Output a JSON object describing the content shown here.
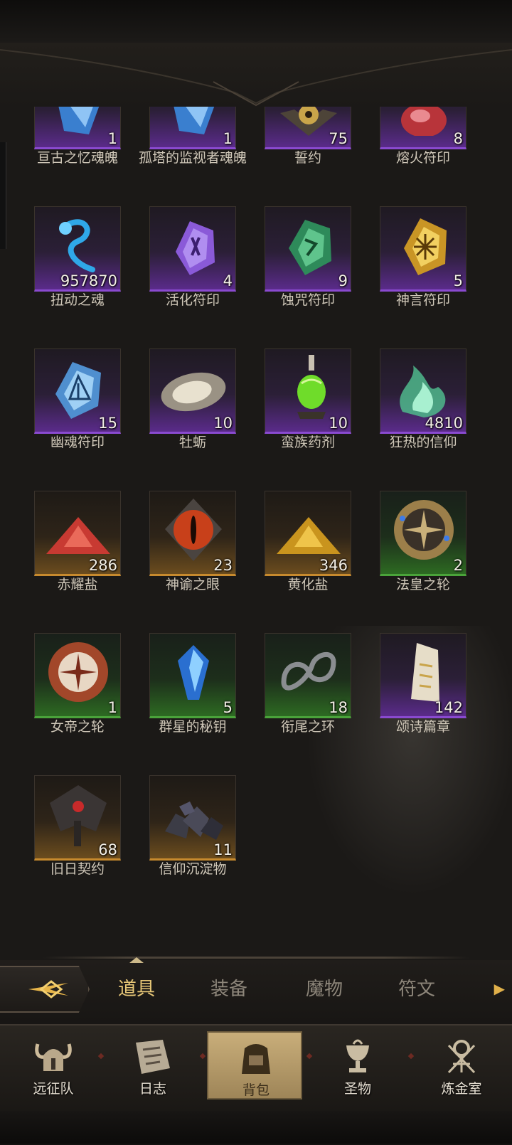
{
  "inventory": {
    "items": [
      {
        "name": "亘古之忆魂魄",
        "count": "1",
        "rarity": "purple",
        "icon": "blue-crystal-soul-icon"
      },
      {
        "name": "孤塔的监视者魂魄",
        "count": "1",
        "rarity": "purple",
        "icon": "blue-crystal-soul-icon"
      },
      {
        "name": "誓约",
        "count": "75",
        "rarity": "purple",
        "icon": "golden-eye-emblem-icon"
      },
      {
        "name": "熔火符印",
        "count": "8",
        "rarity": "purple",
        "icon": "red-rune-stone-icon"
      },
      {
        "name": "扭动之魂",
        "count": "957870",
        "rarity": "purple",
        "icon": "blue-wisp-soul-icon"
      },
      {
        "name": "活化符印",
        "count": "4",
        "rarity": "purple",
        "icon": "purple-rune-stone-icon"
      },
      {
        "name": "蚀咒符印",
        "count": "9",
        "rarity": "purple",
        "icon": "green-rune-stone-icon"
      },
      {
        "name": "神言符印",
        "count": "5",
        "rarity": "purple",
        "icon": "gold-rune-stone-icon"
      },
      {
        "name": "幽魂符印",
        "count": "15",
        "rarity": "purple",
        "icon": "ice-rune-stone-icon"
      },
      {
        "name": "牡蛎",
        "count": "10",
        "rarity": "purple",
        "icon": "oyster-icon"
      },
      {
        "name": "蛮族药剂",
        "count": "10",
        "rarity": "purple",
        "icon": "green-potion-icon"
      },
      {
        "name": "狂热的信仰",
        "count": "4810",
        "rarity": "purple",
        "icon": "green-flame-icon"
      },
      {
        "name": "赤耀盐",
        "count": "286",
        "rarity": "orange",
        "icon": "red-salt-pile-icon"
      },
      {
        "name": "神谕之眼",
        "count": "23",
        "rarity": "orange",
        "icon": "oracle-eye-icon"
      },
      {
        "name": "黄化盐",
        "count": "346",
        "rarity": "orange",
        "icon": "yellow-salt-pile-icon"
      },
      {
        "name": "法皇之轮",
        "count": "2",
        "rarity": "green",
        "icon": "compass-wheel-gold-icon"
      },
      {
        "name": "女帝之轮",
        "count": "1",
        "rarity": "green",
        "icon": "compass-wheel-red-icon"
      },
      {
        "name": "群星的秘钥",
        "count": "5",
        "rarity": "green",
        "icon": "blue-gem-key-icon"
      },
      {
        "name": "衔尾之环",
        "count": "18",
        "rarity": "green",
        "icon": "ouroboros-ring-icon"
      },
      {
        "name": "颂诗篇章",
        "count": "142",
        "rarity": "purple",
        "icon": "scroll-page-icon"
      },
      {
        "name": "旧日契约",
        "count": "68",
        "rarity": "orange",
        "icon": "dark-sigil-icon"
      },
      {
        "name": "信仰沉淀物",
        "count": "11",
        "rarity": "orange",
        "icon": "coal-rocks-icon"
      }
    ]
  },
  "tabs": {
    "items": [
      "道具",
      "装备",
      "魔物",
      "符文"
    ],
    "active": "道具",
    "back_icon": "back-arrow-icon",
    "more_icon": "chevron-right-icon"
  },
  "nav": {
    "items": [
      {
        "label": "远征队",
        "icon": "horned-helmet-icon"
      },
      {
        "label": "日志",
        "icon": "map-scroll-icon"
      },
      {
        "label": "背包",
        "icon": "backpack-icon"
      },
      {
        "label": "圣物",
        "icon": "chalice-icon"
      },
      {
        "label": "炼金室",
        "icon": "alchemy-symbol-icon"
      }
    ],
    "active": "背包"
  },
  "colors": {
    "purple_rarity": "#8a4ad0",
    "orange_rarity": "#c78a2e",
    "green_rarity": "#4aa33a",
    "active_tab": "#e7c777"
  }
}
